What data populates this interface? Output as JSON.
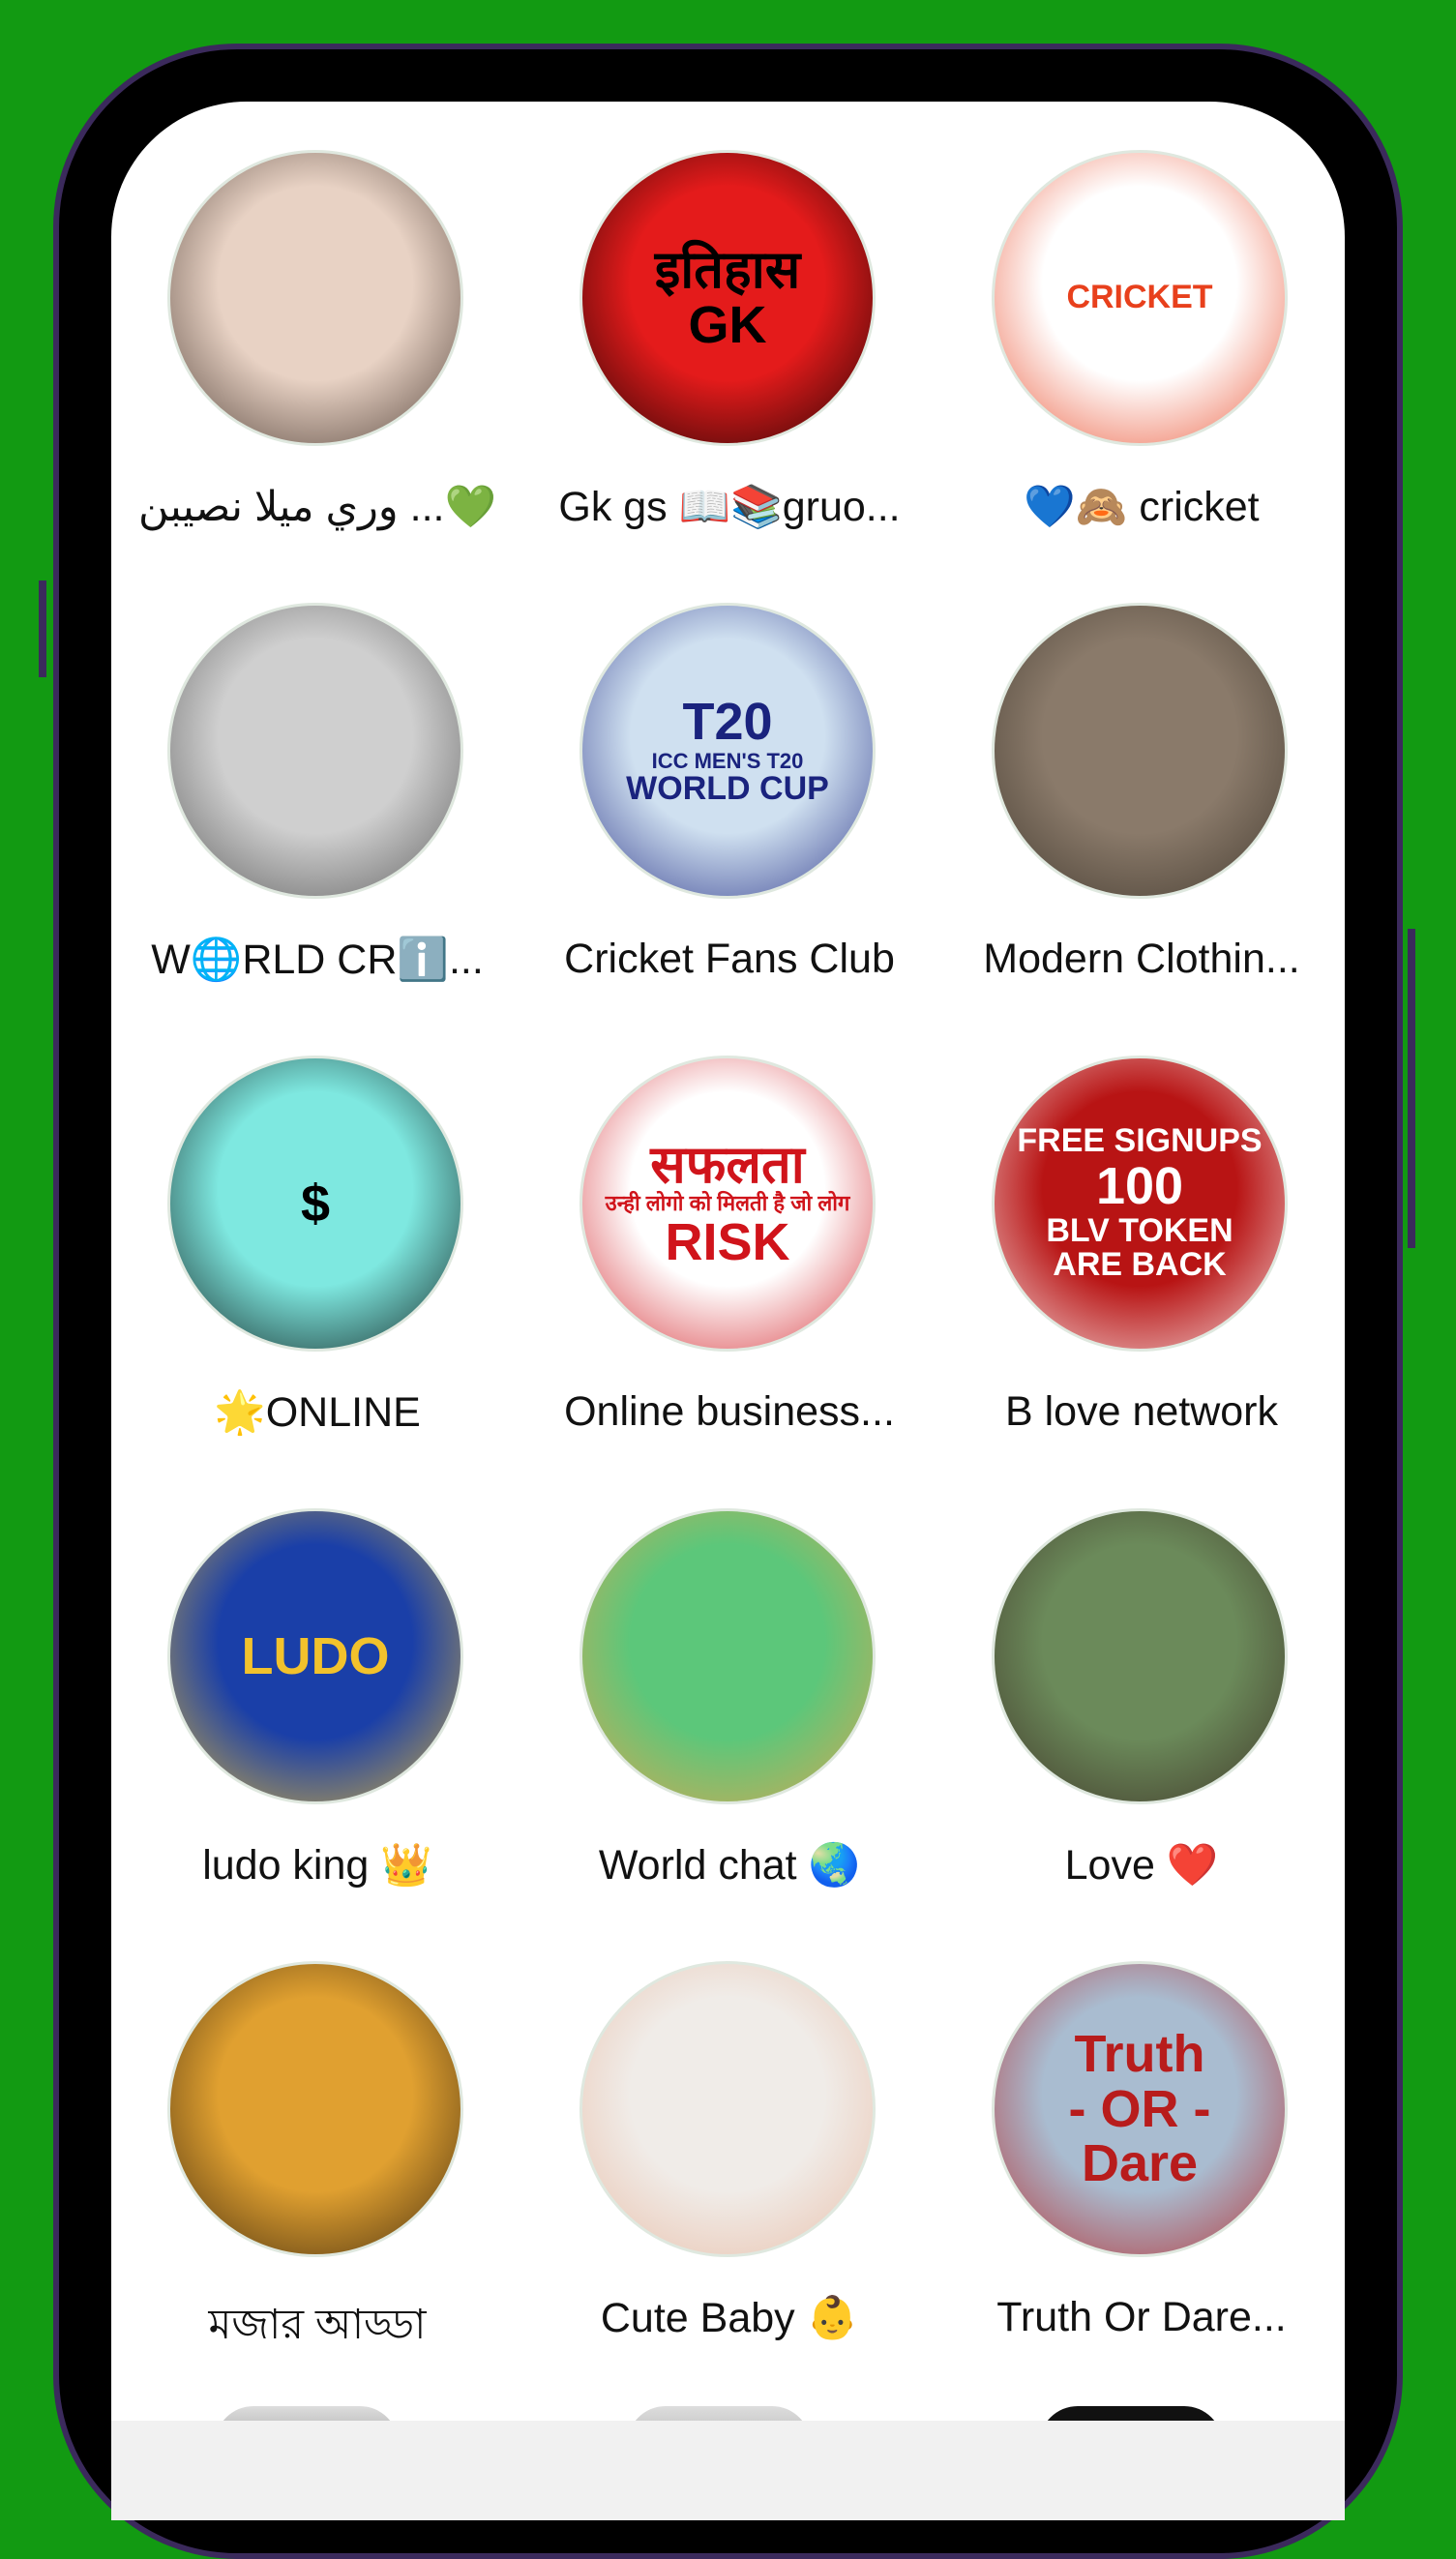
{
  "groups": [
    {
      "label": "وري ميلا نصيبن ...💚",
      "avatar": "woman-portrait",
      "colors": [
        "#e8d2c4",
        "#3a2a22"
      ]
    },
    {
      "label": "Gk gs 📖📚gruo...",
      "avatar": "itihas-gk-logo",
      "logo": [
        "इतिहास",
        "GK"
      ],
      "colors": [
        "#e41b1b",
        "#000000"
      ]
    },
    {
      "label": "💙🙈 cricket",
      "avatar": "cricket-fever-ball",
      "logo": [
        "CRICKET"
      ],
      "colors": [
        "#ffffff",
        "#e8401c"
      ]
    },
    {
      "label": "W🌐RLD CRℹ️...",
      "avatar": "hand-holding-ball",
      "colors": [
        "#cfcfcf",
        "#4a4a4a"
      ]
    },
    {
      "label": "Cricket Fans Club",
      "avatar": "t20-world-cup-logo",
      "logo": [
        "T20",
        "ICC MEN'S T20",
        "WORLD CUP"
      ],
      "colors": [
        "#cfe0f0",
        "#1a237e"
      ]
    },
    {
      "label": "Modern Clothin...",
      "avatar": "doll-photo",
      "colors": [
        "#8a7a6a",
        "#3a3228"
      ]
    },
    {
      "label": "🌟ONLINE",
      "avatar": "money-bag-hand",
      "logo": [
        "$"
      ],
      "colors": [
        "#7ee8e0",
        "#000000"
      ]
    },
    {
      "label": "Online business...",
      "avatar": "safalta-risk-quote",
      "logo": [
        "सफलता",
        "उन्ही लोगो को मिलती है जो लोग",
        "RISK"
      ],
      "colors": [
        "#ffffff",
        "#d0141b"
      ]
    },
    {
      "label": "B love network",
      "avatar": "free-signups-promo",
      "logo": [
        "FREE SIGNUPS",
        "100",
        "BLV TOKEN",
        "ARE BACK"
      ],
      "colors": [
        "#b81414",
        "#ffffff"
      ]
    },
    {
      "label": "ludo king 👑",
      "avatar": "ludo-king-logo",
      "logo": [
        "LUDO"
      ],
      "colors": [
        "#1a3fa8",
        "#f2c22c"
      ]
    },
    {
      "label": "World chat 🌏",
      "avatar": "world-chat-illustration",
      "colors": [
        "#5cc77a",
        "#f0a04a"
      ]
    },
    {
      "label": "Love ❤️",
      "avatar": "woman-saree-photo",
      "colors": [
        "#6b8a5a",
        "#3a2a22"
      ]
    },
    {
      "label": "মজার আড্ডা",
      "avatar": "tree-sunset-photo",
      "colors": [
        "#e0a030",
        "#2a1a0a"
      ]
    },
    {
      "label": "Cute Baby 👶",
      "avatar": "baby-photo",
      "colors": [
        "#f0ece8",
        "#e8b8a0"
      ]
    },
    {
      "label": "Truth Or Dare...",
      "avatar": "truth-or-dare-logo",
      "logo": [
        "Truth",
        "- OR -",
        "Dare"
      ],
      "colors": [
        "#a9bcd0",
        "#b81c1c"
      ]
    }
  ],
  "theme": {
    "background": "#129a12",
    "navbar": "#f1f1f1"
  }
}
